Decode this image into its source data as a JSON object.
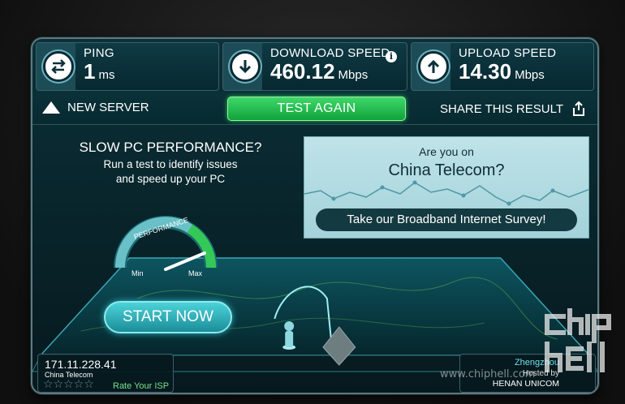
{
  "stats": {
    "ping": {
      "label": "PING",
      "value": "1",
      "unit": "ms"
    },
    "download": {
      "label": "DOWNLOAD SPEED",
      "value": "460.12",
      "unit": "Mbps"
    },
    "upload": {
      "label": "UPLOAD SPEED",
      "value": "14.30",
      "unit": "Mbps"
    }
  },
  "actions": {
    "new_server": "NEW SERVER",
    "test_again": "TEST AGAIN",
    "share": "SHARE THIS RESULT"
  },
  "promo": {
    "title": "SLOW PC PERFORMANCE?",
    "line1": "Run a test to identify issues",
    "line2": "and speed up your PC",
    "gauge_label": "PERFORMANCE",
    "gauge_min": "Min",
    "gauge_max": "Max",
    "start": "START NOW"
  },
  "ad": {
    "question": "Are you on",
    "isp": "China Telecom?",
    "survey": "Take our Broadband Internet Survey!"
  },
  "client": {
    "ip": "171.11.228.41",
    "isp": "China Telecom",
    "stars": 0,
    "rate": "Rate Your ISP"
  },
  "server": {
    "city": "Zhengzhou",
    "hosted_by": "Hosted by",
    "isp": "HENAN UNICOM"
  },
  "watermark": {
    "url": "www.chiphell.com",
    "logo": "chiphell"
  },
  "colors": {
    "accent_green": "#1fb84a",
    "accent_teal": "#2ab7c1",
    "panel_bg": "#0b3038"
  }
}
